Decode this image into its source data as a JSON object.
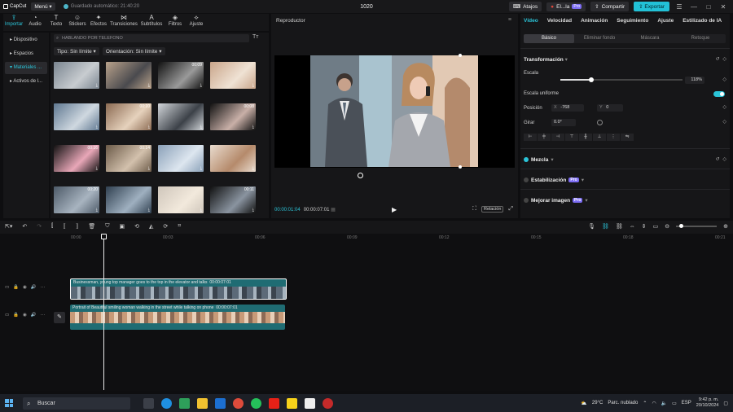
{
  "titlebar": {
    "app_name": "CapCut",
    "menu_label": "Menú",
    "autosave": "Guardado automático: 21:40:20",
    "project_title": "1020",
    "shortcuts": "Atajos",
    "user": "El...la",
    "pro_badge": "Pro",
    "share": "Compartir",
    "export": "Exportar",
    "minimize": "—",
    "maximize": "□",
    "close": "✕"
  },
  "toolbar": {
    "tools": [
      {
        "label": "Importar",
        "icon": "import-icon",
        "glyph": "⇪"
      },
      {
        "label": "Audio",
        "icon": "audio-icon",
        "glyph": "◔"
      },
      {
        "label": "Texto",
        "icon": "text-icon",
        "glyph": "T"
      },
      {
        "label": "Stickers",
        "icon": "sticker-icon",
        "glyph": "☺"
      },
      {
        "label": "Efectos",
        "icon": "effects-icon",
        "glyph": "✦"
      },
      {
        "label": "Transiciones",
        "icon": "transition-icon",
        "glyph": "⋈"
      },
      {
        "label": "Subtítulos",
        "icon": "subtitles-icon",
        "glyph": "A"
      },
      {
        "label": "Filtros",
        "icon": "filters-icon",
        "glyph": "◈"
      },
      {
        "label": "Ajuste",
        "icon": "adjust-icon",
        "glyph": "⟡"
      }
    ]
  },
  "leftnav": {
    "items": [
      "Dispositivo",
      "Espacios",
      "Materiales ...",
      "Activos de l..."
    ]
  },
  "media": {
    "search_placeholder": "HABLANDO POR TELEFONO",
    "tt": "Tт",
    "filter_type": "Tipo: Sin límite",
    "filter_orientation": "Orientación: Sin límite",
    "thumbs": [
      {
        "dur": "",
        "c1": "#7a8590",
        "c2": "#c8ccd0"
      },
      {
        "dur": "",
        "c1": "#b9a28b",
        "c2": "#4a4a4e"
      },
      {
        "dur": "00:09",
        "c1": "#111111",
        "c2": "#9a9a9a"
      },
      {
        "dur": "",
        "c1": "#c9a58a",
        "c2": "#efe2d4"
      },
      {
        "dur": "",
        "c1": "#5f7891",
        "c2": "#cfd8e0"
      },
      {
        "dur": "00:10",
        "c1": "#8b6a52",
        "c2": "#e6d2bd"
      },
      {
        "dur": "",
        "c1": "#d2d6da",
        "c2": "#3c4148"
      },
      {
        "dur": "00:08",
        "c1": "#111111",
        "c2": "#c9b0a8"
      },
      {
        "dur": "00:16",
        "c1": "#111111",
        "c2": "#e9a7b8"
      },
      {
        "dur": "00:14",
        "c1": "#6b5a48",
        "c2": "#d3c1ad"
      },
      {
        "dur": "",
        "c1": "#8aa0b8",
        "c2": "#dde6ef"
      },
      {
        "dur": "",
        "c1": "#e9dccf",
        "c2": "#b58a6b"
      },
      {
        "dur": "00:20",
        "c1": "#4d5a68",
        "c2": "#a8b4c0"
      },
      {
        "dur": "",
        "c1": "#304050",
        "c2": "#9fb0c0"
      },
      {
        "dur": "",
        "c1": "#cfc6bb",
        "c2": "#f2e9dc"
      },
      {
        "dur": "00:11",
        "c1": "#111111",
        "c2": "#8a94a0"
      }
    ]
  },
  "player": {
    "title": "Reproductor",
    "current_time": "00:00:01:04",
    "total_time": "00:00:07:01",
    "ratio_label": "Relación"
  },
  "props": {
    "tabs": [
      "Vídeo",
      "Velocidad",
      "Animación",
      "Seguimiento",
      "Ajuste",
      "Estilizado de IA"
    ],
    "subtabs": [
      "Básico",
      "Eliminar fondo",
      "Máscara",
      "Retoque"
    ],
    "transform": "Transformación",
    "scale_label": "Escala",
    "scale_value": "118%",
    "scale_fraction": 0.25,
    "uniform_scale": "Escala uniforme",
    "position_label": "Posición",
    "pos_x_label": "X",
    "pos_x": "-768",
    "pos_y_label": "Y",
    "pos_y": "0",
    "rotate_label": "Girar",
    "rotate_value": "0.0°",
    "blend": "Mezcla",
    "stabilize": "Estabilización",
    "enhance": "Mejorar imagen",
    "pro_badge": "Pro"
  },
  "timeline": {
    "ruler": [
      "00:00",
      "00:03",
      "00:06",
      "00:09",
      "00:12",
      "00:15",
      "00:18",
      "00:21"
    ],
    "clip1_title": "Businessman, young top manager goes to the top in the elevator and talks",
    "clip1_dur": "00:00:07:01",
    "clip2_title": "Portrait of Beautiful smiling woman walking in the street while talking on phone",
    "clip2_dur": "00:00:07:01"
  },
  "taskbar": {
    "search": "Buscar",
    "weather": "29°C",
    "weather_desc": "Parc. nublado",
    "lang": "ESP",
    "time": "9:42 p. m.",
    "date": "20/10/2024"
  },
  "colors": {
    "accent": "#2bc4d8",
    "clip_bg": "#1f6c73",
    "panel": "#161618"
  }
}
